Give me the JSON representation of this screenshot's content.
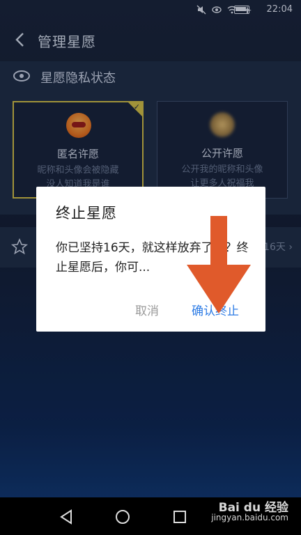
{
  "status_bar": {
    "time": "22:04"
  },
  "header": {
    "title": "管理星愿"
  },
  "privacy": {
    "title": "星愿隐私状态",
    "options": [
      {
        "title": "匿名许愿",
        "desc": [
          "昵称和头像会被隐藏",
          "没人知道我是谁"
        ],
        "selected": true
      },
      {
        "title": "公开许愿",
        "desc": [
          "公开我的昵称和头像",
          "让更多人祝福我"
        ],
        "selected": false
      }
    ]
  },
  "wish_row": {
    "value": "16天"
  },
  "dialog": {
    "title": "终止星愿",
    "body": "你已坚持16天，就这样放弃了吗？终止星愿后，你可...",
    "cancel_label": "取消",
    "confirm_label": "确认终止"
  },
  "watermark": {
    "brand": "Bai du 经验",
    "url": "jingyan.baidu.com"
  },
  "colors": {
    "accent": "#2c7be5",
    "selected_border": "#d7c44c",
    "arrow": "#e05a2b"
  }
}
